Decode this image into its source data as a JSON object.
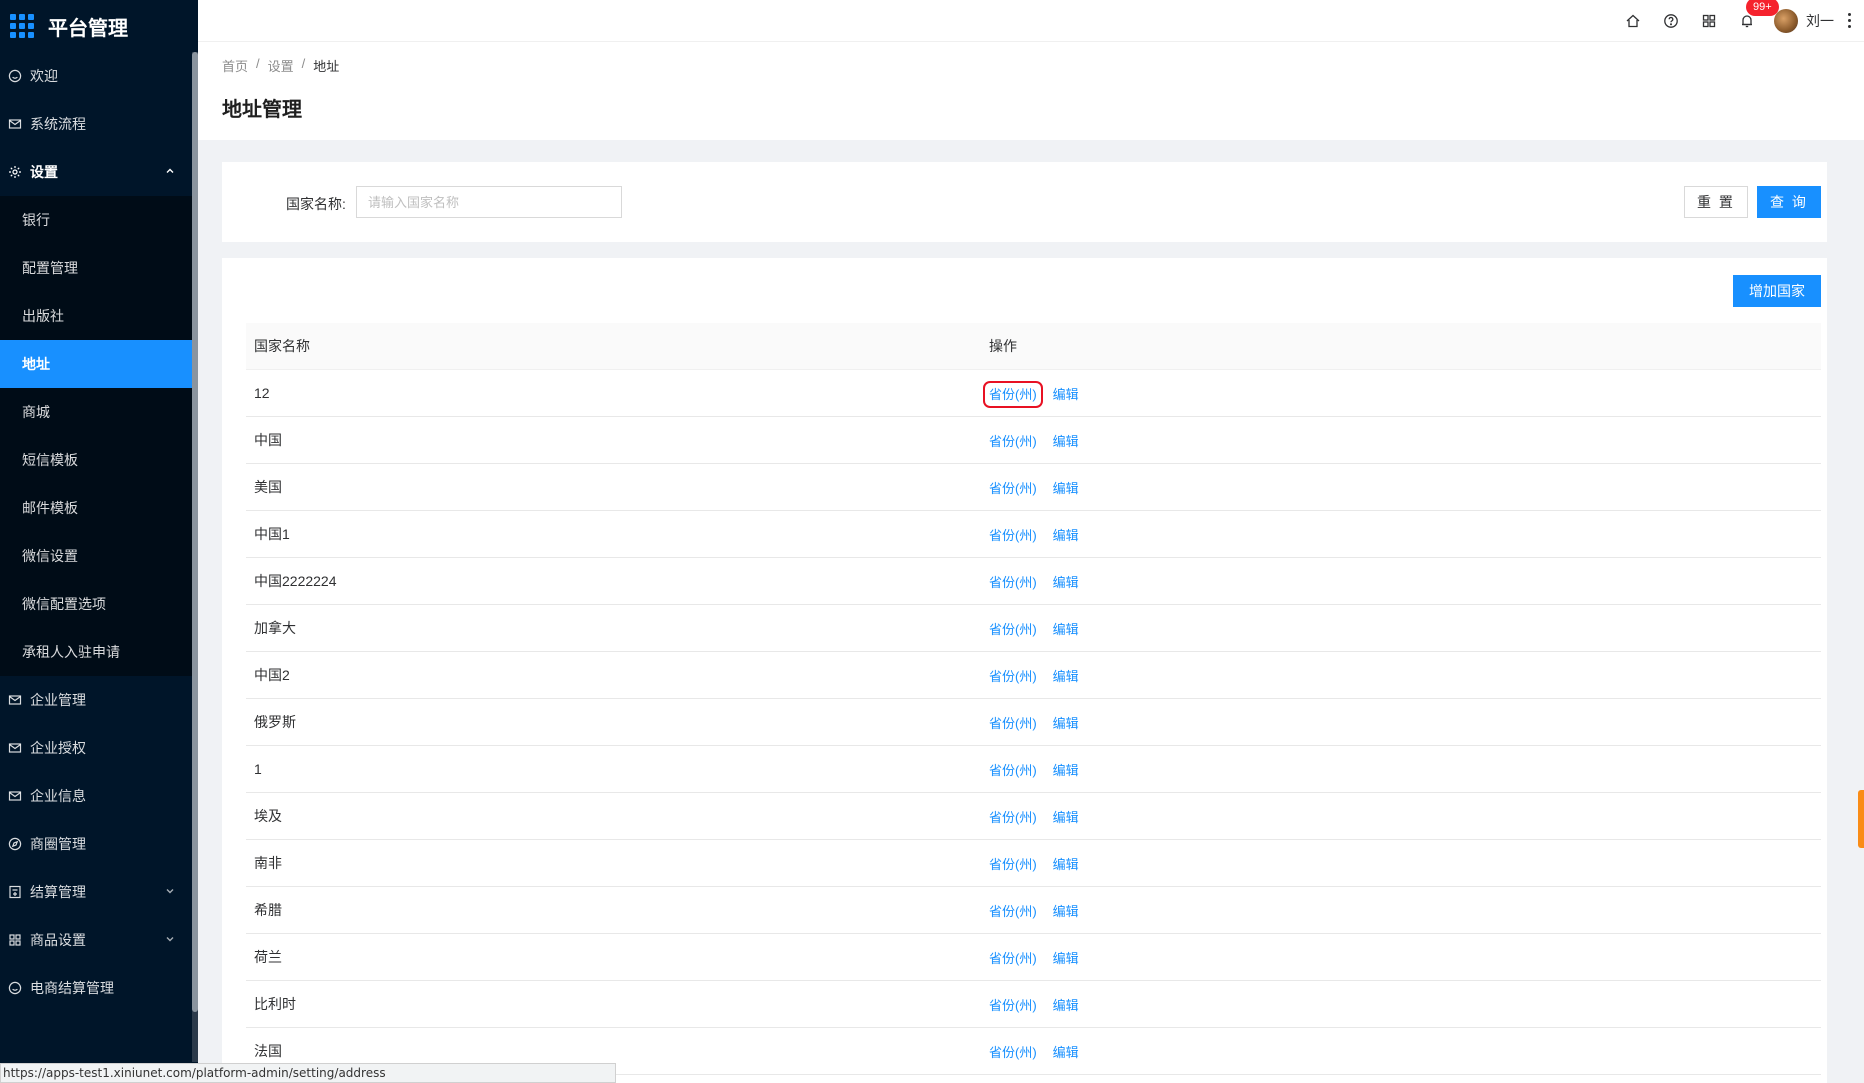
{
  "app": {
    "title": "平台管理"
  },
  "sidebar": {
    "items": [
      {
        "label": "欢迎",
        "icon": "smile-icon"
      },
      {
        "label": "系统流程",
        "icon": "mail-icon"
      },
      {
        "label": "设置",
        "icon": "gear-icon",
        "open": true,
        "children": [
          "银行",
          "配置管理",
          "出版社",
          "地址",
          "商城",
          "短信模板",
          "邮件模板",
          "微信设置",
          "微信配置选项",
          "承租人入驻申请"
        ],
        "active_child": "地址"
      },
      {
        "label": "企业管理",
        "icon": "mail-icon"
      },
      {
        "label": "企业授权",
        "icon": "mail-icon"
      },
      {
        "label": "企业信息",
        "icon": "mail-icon"
      },
      {
        "label": "商圈管理",
        "icon": "compass-icon"
      },
      {
        "label": "结算管理",
        "icon": "calculator-icon",
        "expandable": true
      },
      {
        "label": "商品设置",
        "icon": "grid-icon",
        "expandable": true
      },
      {
        "label": "电商结算管理",
        "icon": "smile-icon"
      }
    ]
  },
  "topbar": {
    "notification_badge": "99+",
    "user_name": "刘一"
  },
  "breadcrumb": [
    "首页",
    "设置",
    "地址"
  ],
  "page_title": "地址管理",
  "search": {
    "label": "国家名称:",
    "placeholder": "请输入国家名称",
    "value": "",
    "reset_label": "重 置",
    "query_label": "查 询"
  },
  "table": {
    "add_label": "增加国家",
    "columns": [
      "国家名称",
      "操作"
    ],
    "action_provinces": "省份(州)",
    "action_edit": "编辑",
    "rows": [
      "12",
      "中国",
      "美国",
      "中国1",
      "中国2222224",
      "加拿大",
      "中国2",
      "俄罗斯",
      "1",
      "埃及",
      "南非",
      "希腊",
      "荷兰",
      "比利时",
      "法国"
    ]
  },
  "statusbar": {
    "url": "https://apps-test1.xiniunet.com/platform-admin/setting/address"
  },
  "colors": {
    "sidebar_bg": "#001529",
    "primary": "#1890ff",
    "highlight_box": "#e81123",
    "badge": "#f5222d"
  }
}
